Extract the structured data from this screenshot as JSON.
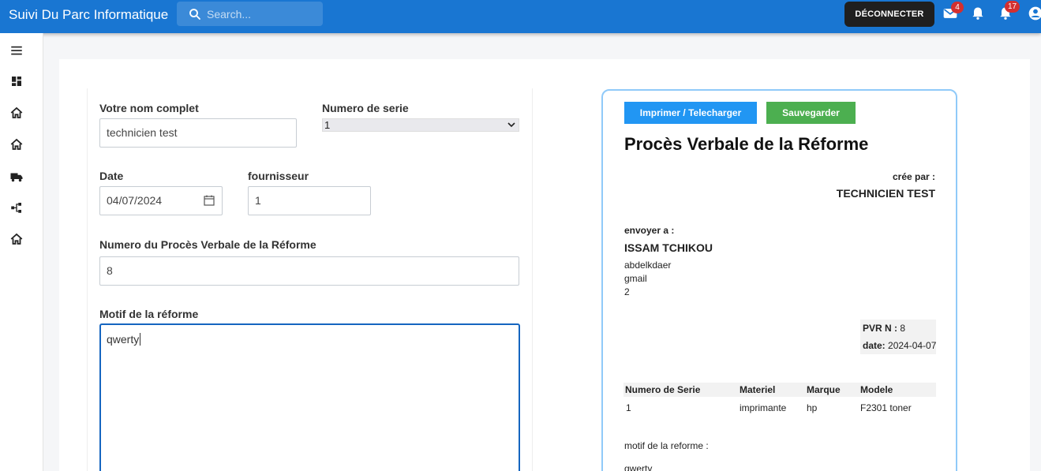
{
  "header": {
    "app_title": "Suivi Du Parc Informatique",
    "search_placeholder": "Search...",
    "logout_label": "DÉCONNECTER",
    "mail_count": "4",
    "notifications_count": "17",
    "accent_color": "#1976d2"
  },
  "sidebar": {
    "items": [
      {
        "icon": "menu-icon"
      },
      {
        "icon": "dashboard-icon"
      },
      {
        "icon": "home-icon"
      },
      {
        "icon": "home-icon"
      },
      {
        "icon": "truck-icon"
      },
      {
        "icon": "hierarchy-icon"
      },
      {
        "icon": "home-icon"
      }
    ]
  },
  "form": {
    "full_name_label": "Votre nom complet",
    "full_name_value": "technicien test",
    "serial_label": "Numero de serie",
    "serial_value": "1",
    "date_label": "Date",
    "date_value": "04/07/2024",
    "supplier_label": "fournisseur",
    "supplier_value": "1",
    "pv_number_label": "Numero du Procès Verbale de la Réforme",
    "pv_number_value": "8",
    "reason_label": "Motif de la réforme",
    "reason_value": "qwerty"
  },
  "preview": {
    "print_label": "Imprimer / Telecharger",
    "save_label": "Sauvegarder",
    "title": "Procès Verbale de la Réforme",
    "created_by_label": "crée par :",
    "created_by_value": "TECHNICIEN TEST",
    "sent_to_label": "envoyer a :",
    "recipient_name": "ISSAM TCHIKOU",
    "recipient_line1": "abdelkdaer",
    "recipient_line2": "gmail",
    "recipient_line3": "2",
    "pvr_label": "PVR N :",
    "pvr_value": "8",
    "date_label": "date:",
    "date_value": "2024-04-07",
    "table": {
      "headers": [
        "Numero de Serie",
        "Materiel",
        "Marque",
        "Modele"
      ],
      "rows": [
        [
          "1",
          "imprimante",
          "hp",
          "F2301 toner"
        ]
      ]
    },
    "reason_label": "motif de la reforme :",
    "reason_value": "qwerty"
  }
}
